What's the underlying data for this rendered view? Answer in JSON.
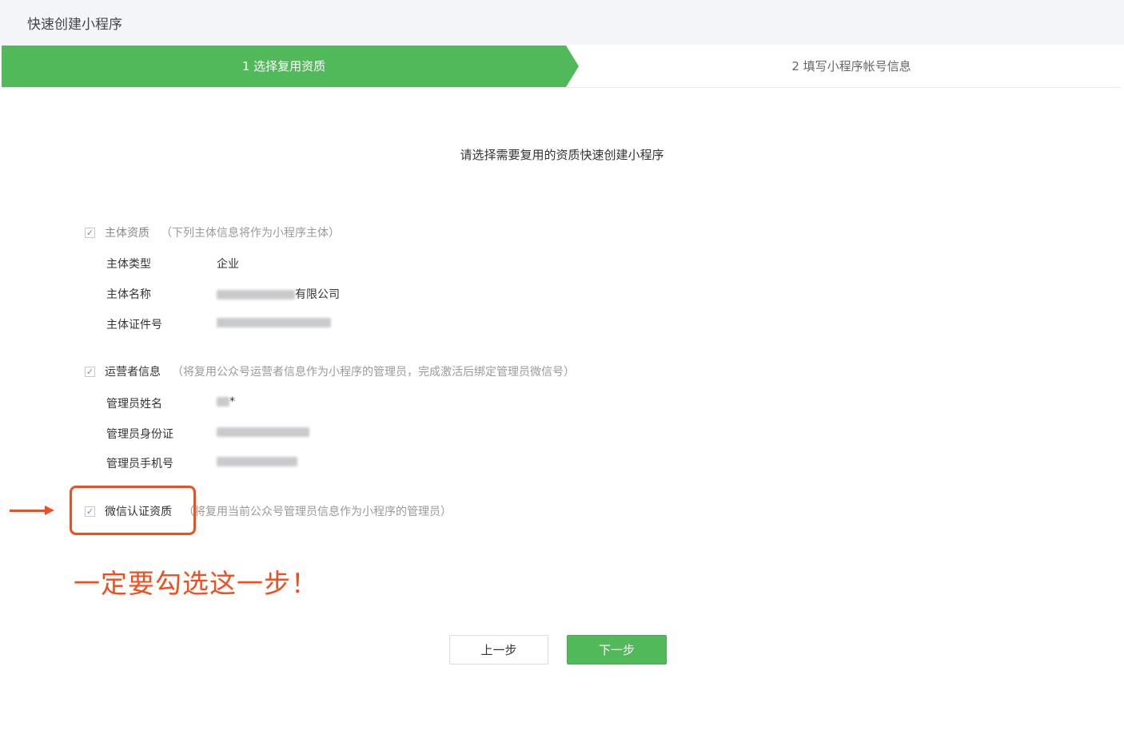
{
  "header": {
    "title": "快速创建小程序"
  },
  "steps": {
    "step1": "1 选择复用资质",
    "step2": "2 填写小程序帐号信息"
  },
  "subtitle": "请选择需要复用的资质快速创建小程序",
  "sections": [
    {
      "label": "主体资质",
      "note": "（下列主体信息将作为小程序主体）",
      "checked": true,
      "fields": [
        {
          "label": "主体类型",
          "value": "企业"
        },
        {
          "label": "主体名称",
          "value": "有限公司"
        },
        {
          "label": "主体证件号",
          "value": ""
        }
      ]
    },
    {
      "label": "运营者信息",
      "note": "（将复用公众号运营者信息作为小程序的管理员，完成激活后绑定管理员微信号）",
      "checked": true,
      "fields": [
        {
          "label": "管理员姓名",
          "value": "*"
        },
        {
          "label": "管理员身份证",
          "value": ""
        },
        {
          "label": "管理员手机号",
          "value": ""
        }
      ]
    },
    {
      "label": "微信认证资质",
      "note": "（将复用当前公众号管理员信息作为小程序的管理员）",
      "checked": true
    }
  ],
  "checkmark": "✓",
  "annotation": "一定要勾选这一步！",
  "buttons": {
    "prev": "上一步",
    "next": "下一步"
  },
  "colors": {
    "accent": "#52b95a",
    "annotation": "#f14e1f"
  },
  "icons": [
    "checkbox-checked-icon",
    "arrow-right-icon"
  ]
}
